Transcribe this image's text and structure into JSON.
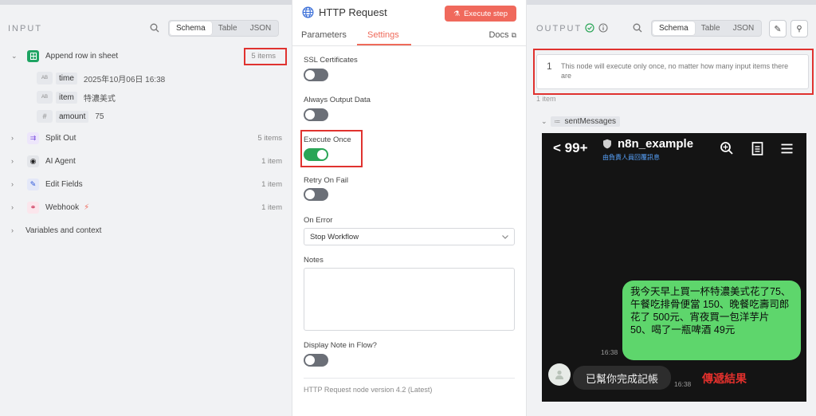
{
  "input": {
    "title": "INPUT",
    "tabs": [
      "Schema",
      "Table",
      "JSON"
    ],
    "tree": [
      {
        "label": "Append row in sheet",
        "count": "5 items",
        "expanded": true
      },
      {
        "label": "Split Out",
        "count": "5 items"
      },
      {
        "label": "AI Agent",
        "count": "1 item"
      },
      {
        "label": "Edit Fields",
        "count": "1 item"
      },
      {
        "label": "Webhook",
        "count": "1 item"
      }
    ],
    "fields": [
      {
        "type": "AB",
        "key": "time",
        "value": "2025年10月06日 16:38"
      },
      {
        "type": "AB",
        "key": "item",
        "value": "特濃美式"
      },
      {
        "type": "#",
        "key": "amount",
        "value": "75"
      }
    ],
    "variables_label": "Variables and context"
  },
  "params": {
    "node_title": "HTTP Request",
    "execute_label": "Execute step",
    "tab_parameters": "Parameters",
    "tab_settings": "Settings",
    "docs_label": "Docs",
    "ssl_label": "SSL Certificates",
    "always_output_label": "Always Output Data",
    "execute_once_label": "Execute Once",
    "retry_label": "Retry On Fail",
    "on_error_label": "On Error",
    "on_error_value": "Stop Workflow",
    "notes_label": "Notes",
    "display_note_label": "Display Note in Flow?",
    "version": "HTTP Request node version 4.2 (Latest)"
  },
  "output": {
    "title": "OUTPUT",
    "tabs": [
      "Schema",
      "Table",
      "JSON"
    ],
    "notice_num": "1",
    "notice_text": "This node will execute only once, no matter how many input items there are",
    "item_count": "1 item",
    "field_name": "sentMessages"
  },
  "chat": {
    "back": "99+",
    "name": "n8n_example",
    "subtitle": "由負責人員回覆訊息",
    "outgoing": "我今天早上買一杯特濃美式花了75、午餐吃排骨便當 150、晚餐吃壽司郎花了 500元、宵夜買一包洋芋片 50、喝了一瓶啤酒 49元",
    "outgoing_time": "16:38",
    "incoming": "已幫你完成記帳",
    "incoming_time": "16:38",
    "annotation": "傳遞結果"
  },
  "colors": {
    "accent": "#ef6a5a",
    "toggle_on": "#2aa556",
    "highlight": "#e0322f",
    "bubble_green": "#5ed66c"
  }
}
